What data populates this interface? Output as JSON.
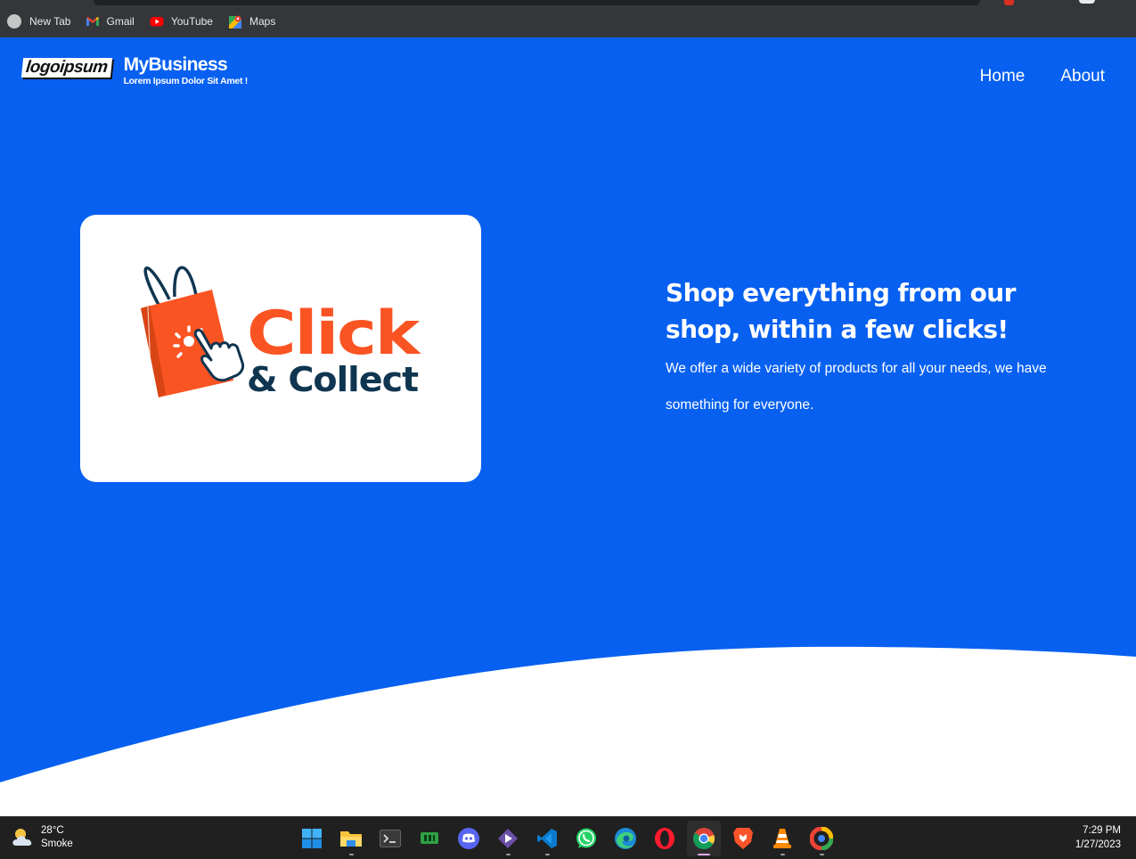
{
  "browser": {
    "bookmarks": [
      {
        "label": "New Tab",
        "icon": "new-tab-icon"
      },
      {
        "label": "Gmail",
        "icon": "gmail-icon"
      },
      {
        "label": "YouTube",
        "icon": "youtube-icon"
      },
      {
        "label": "Maps",
        "icon": "maps-icon"
      }
    ]
  },
  "site": {
    "logo_text": "logoipsum",
    "brand_name": "MyBusiness",
    "tagline": "Lorem Ipsum Dolor Sit Amet !",
    "nav": [
      {
        "label": "Home"
      },
      {
        "label": "About"
      }
    ],
    "hero_image": {
      "word_click": "Click",
      "word_collect": "& Collect"
    },
    "hero": {
      "title": "Shop everything from our shop, within a few clicks!",
      "body": "We offer a wide variety of products for all your needs, we have something for everyone."
    },
    "colors": {
      "primary_blue": "#0760f0",
      "accent_orange": "#fa5423",
      "navy": "#0f3550"
    }
  },
  "taskbar": {
    "weather": {
      "temp": "28°C",
      "condition": "Smoke",
      "icon": "partly-cloudy-icon"
    },
    "apps": [
      {
        "name": "start-button",
        "icon": "windows-logo-icon",
        "running": false
      },
      {
        "name": "file-explorer",
        "icon": "folder-icon",
        "running": true
      },
      {
        "name": "terminal",
        "icon": "terminal-icon",
        "running": false
      },
      {
        "name": "taskbar-app-4",
        "icon": "green-app-icon",
        "running": false
      },
      {
        "name": "discord",
        "icon": "discord-icon",
        "running": false
      },
      {
        "name": "taskbar-app-6",
        "icon": "purple-diamond-icon",
        "running": true
      },
      {
        "name": "vscode",
        "icon": "vscode-icon",
        "running": true
      },
      {
        "name": "whatsapp",
        "icon": "whatsapp-icon",
        "running": false
      },
      {
        "name": "edge",
        "icon": "edge-icon",
        "running": false
      },
      {
        "name": "opera",
        "icon": "opera-icon",
        "running": false
      },
      {
        "name": "chrome",
        "icon": "chrome-icon",
        "running": true,
        "active": true
      },
      {
        "name": "brave",
        "icon": "brave-icon",
        "running": false
      },
      {
        "name": "vlc",
        "icon": "vlc-icon",
        "running": true
      },
      {
        "name": "taskbar-app-14",
        "icon": "ring-app-icon",
        "running": true
      }
    ],
    "clock": {
      "time": "7:29 PM",
      "date": "1/27/2023"
    }
  }
}
